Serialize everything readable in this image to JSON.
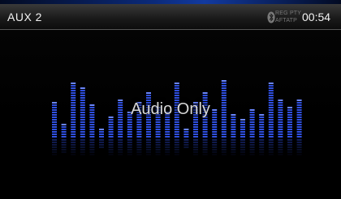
{
  "status_bar": {
    "source": "AUX 2",
    "indicators": {
      "reg": "REG",
      "pty": "PTY",
      "af": "AF",
      "ta": "TA",
      "tp": "TP"
    },
    "clock": "00:54"
  },
  "main": {
    "message": "Audio Only"
  },
  "visualizer": {
    "bar_levels": [
      0.56,
      0.22,
      0.88,
      0.82,
      0.52,
      0.16,
      0.34,
      0.6,
      0.42,
      0.56,
      0.74,
      0.5,
      0.44,
      0.9,
      0.14,
      0.56,
      0.74,
      0.46,
      0.94,
      0.4,
      0.32,
      0.46,
      0.4,
      0.88,
      0.6,
      0.5,
      0.62
    ],
    "colors": {
      "bar": "#2f4fe0",
      "bar_highlight": "#6a86ff",
      "reflection": "#1a2c80",
      "accent": "#0b2a7a"
    }
  },
  "icons": {
    "bluetooth": "bluetooth-icon"
  }
}
